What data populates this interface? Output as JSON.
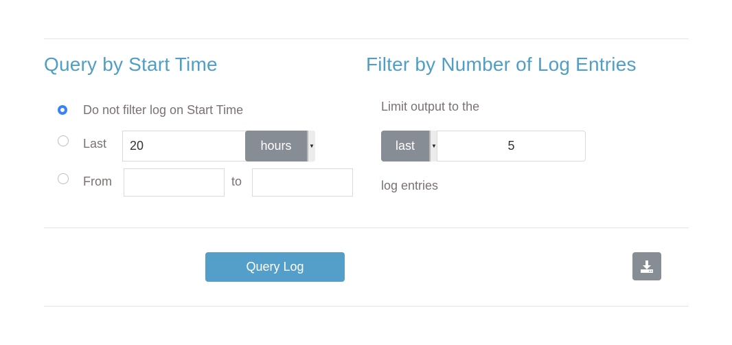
{
  "start_time": {
    "title": "Query by Start Time",
    "options": [
      {
        "label": "Do not filter log on Start Time",
        "checked": true
      },
      {
        "label": "Last",
        "checked": false
      },
      {
        "label": "From",
        "checked": false
      }
    ],
    "last_value": "20",
    "last_unit": "hours",
    "from_value": "",
    "to_label": "to",
    "to_value": ""
  },
  "entries": {
    "title": "Filter by Number of Log Entries",
    "limit_label": "Limit output to the",
    "position_select": "last",
    "count_value": "5",
    "suffix_label": "log entries"
  },
  "actions": {
    "query_label": "Query Log",
    "download_icon": "download-icon"
  }
}
